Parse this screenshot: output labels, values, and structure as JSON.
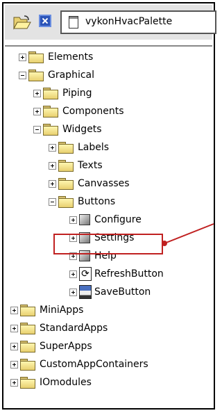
{
  "toolbar": {
    "open_icon": "folder-open-icon",
    "close_icon": "close-icon",
    "palette_name": "vykonHvacPalette"
  },
  "tree": [
    {
      "id": "elements",
      "label": "Elements"
    },
    {
      "id": "graphical",
      "label": "Graphical"
    },
    {
      "id": "piping",
      "label": "Piping"
    },
    {
      "id": "components",
      "label": "Components"
    },
    {
      "id": "widgets",
      "label": "Widgets"
    },
    {
      "id": "labels",
      "label": "Labels"
    },
    {
      "id": "texts",
      "label": "Texts"
    },
    {
      "id": "canvasses",
      "label": "Canvasses"
    },
    {
      "id": "buttons",
      "label": "Buttons"
    },
    {
      "id": "configure",
      "label": "Configure"
    },
    {
      "id": "settings",
      "label": "Settings"
    },
    {
      "id": "help",
      "label": "Help"
    },
    {
      "id": "refreshbutton",
      "label": "RefreshButton"
    },
    {
      "id": "savebutton",
      "label": "SaveButton"
    },
    {
      "id": "miniapps",
      "label": "MiniApps"
    },
    {
      "id": "standardapps",
      "label": "StandardApps"
    },
    {
      "id": "superapps",
      "label": "SuperApps"
    },
    {
      "id": "customappcontainers",
      "label": "CustomAppContainers"
    },
    {
      "id": "iomodules",
      "label": "IOmodules"
    }
  ],
  "highlight": {
    "target": "Settings",
    "color": "#c02020"
  }
}
